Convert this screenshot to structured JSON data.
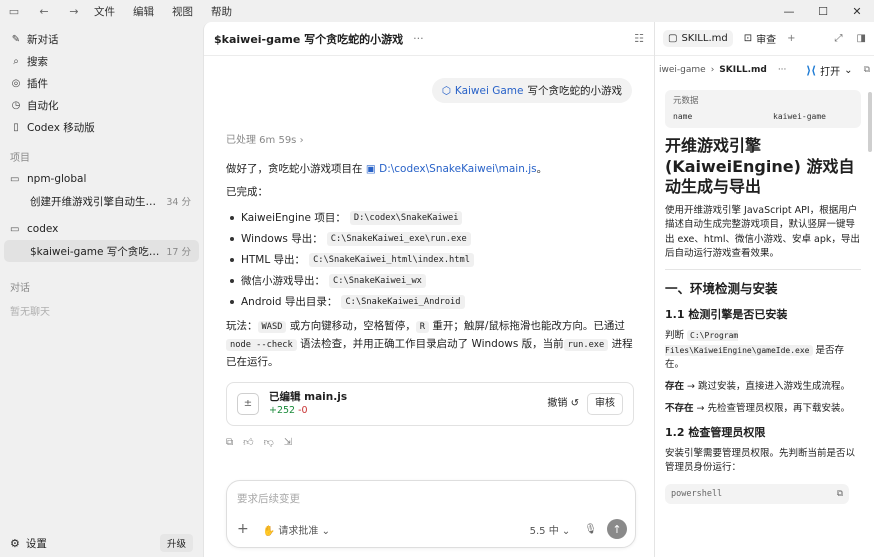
{
  "titlebar": {
    "menu": [
      "文件",
      "编辑",
      "视图",
      "帮助"
    ],
    "icons": [
      "sidebar-toggle-icon",
      "back-arrow-icon",
      "forward-arrow-icon"
    ],
    "window": [
      "minimize",
      "maximize",
      "close"
    ]
  },
  "sidebar": {
    "nav": [
      {
        "label": "新对话",
        "icon": "edit-icon"
      },
      {
        "label": "搜索",
        "icon": "search-icon"
      },
      {
        "label": "插件",
        "icon": "plugin-icon"
      },
      {
        "label": "自动化",
        "icon": "clock-icon"
      },
      {
        "label": "Codex 移动版",
        "icon": "phone-icon"
      }
    ],
    "projects_label": "项目",
    "folders": [
      {
        "name": "npm-global",
        "threads": [
          {
            "title": "创建开维游戏引擎自动生成游戏 ...",
            "ago": "34 分"
          }
        ]
      },
      {
        "name": "codex",
        "threads": [
          {
            "title": "$kaiwei-game 写个贪吃蛇的小...",
            "ago": "17 分"
          }
        ]
      }
    ],
    "chats_label": "对话",
    "chats_empty": "暂无聊天",
    "settings": "设置",
    "upgrade": "升级"
  },
  "main": {
    "title": "$kaiwei-game 写个贪吃蛇的小游戏",
    "user_tag": "Kaiwei Game",
    "user_text": "写个贪吃蛇的小游戏",
    "processed": "已处理 6m 59s",
    "intro": "做好了，贪吃蛇小游戏项目在",
    "intro_link": "D:\\codex\\SnakeKaiwei\\main.js",
    "intro_end": "。",
    "done_label": "已完成：",
    "items": [
      {
        "label": "KaiweiEngine 项目：",
        "code": "D:\\codex\\SnakeKaiwei"
      },
      {
        "label": "Windows 导出：",
        "code": "C:\\SnakeKaiwei_exe\\run.exe"
      },
      {
        "label": "HTML 导出：",
        "code": "C:\\SnakeKaiwei_html\\index.html"
      },
      {
        "label": "微信小游戏导出：",
        "code": "C:\\SnakeKaiwei_wx"
      },
      {
        "label": "Android 导出目录：",
        "code": "C:\\SnakeKaiwei_Android"
      }
    ],
    "play": {
      "t1": "玩法：",
      "c1": "WASD",
      "t2": "或方向键移动，空格暂停，",
      "c2": "R",
      "t3": "重开；触屏/鼠标拖滑也能改方向。已通过",
      "c3": "node --check",
      "t4": "语法检查，并用正确工作目录启动了 Windows 版，当前",
      "c4": "run.exe",
      "t5": "进程已在运行。"
    },
    "edit": {
      "title": "已编辑 main.js",
      "plus": "+252",
      "minus": "-0",
      "undo": "撤销",
      "review": "审核"
    },
    "composer": {
      "placeholder": "要求后续变更",
      "approval": "请求批准",
      "model": "5.5 中"
    }
  },
  "right": {
    "tabs": [
      {
        "label": "SKILL.md"
      },
      {
        "label": "审查"
      }
    ],
    "path_prefix": "iwei-game",
    "path_file": "SKILL.md",
    "open_label": "打开",
    "meta_label": "元数据",
    "meta_key": "name",
    "meta_value": "kaiwei-game",
    "h1": "开维游戏引擎(KaiweiEngine) 游戏自动生成与导出",
    "desc": "使用开维游戏引擎 JavaScript API，根据用户描述自动生成完整游戏项目，默认竖屏一键导出 exe、html、微信小游戏、安卓 apk，导出后自动运行游戏查看效果。",
    "h2": "一、环境检测与安装",
    "h3a": "1.1 检测引擎是否已安装",
    "judge_prefix": "判断",
    "judge_code": "C:\\Program Files\\KaiweiEngine\\gameIde.exe",
    "judge_suffix": "是否存在。",
    "exists_label": "存在",
    "exists_text": "→ 跳过安装，直接进入游戏生成流程。",
    "notexists_label": "不存在",
    "notexists_text": "→ 先检查管理员权限，再下载安装。",
    "h3b": "1.2 检查管理员权限",
    "admin_text": "安装引擎需要管理员权限。先判断当前是否以管理员身份运行：",
    "shell_label": "powershell"
  }
}
